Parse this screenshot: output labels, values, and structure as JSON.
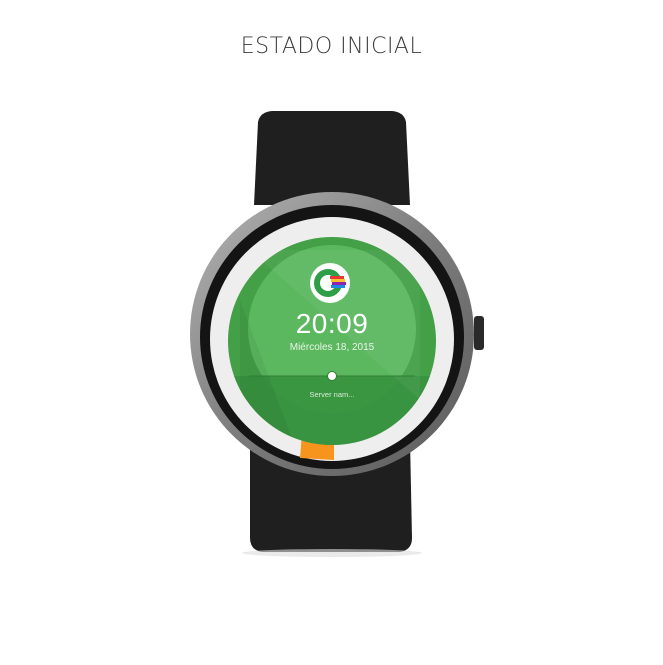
{
  "page": {
    "title": "ESTADO INICIAL"
  },
  "watchface": {
    "time": "20:09",
    "date": "Miércoles 18, 2015",
    "server": "Server nam...",
    "progress_fraction": 0.05
  },
  "colors": {
    "strap": "#1f1f1f",
    "bezel": "#141414",
    "case_metal": "#8c8c8c",
    "ring": "#eeeeee",
    "face_outer": "#43a047",
    "face_inner": "#5cb85f",
    "face_lower": "#37923f",
    "progress": "#f7941d",
    "logo": "#2e9e48"
  },
  "icons": {
    "app_logo": "c-logo-icon",
    "crown": "crown-button-icon",
    "indicator": "dot-indicator-icon"
  }
}
